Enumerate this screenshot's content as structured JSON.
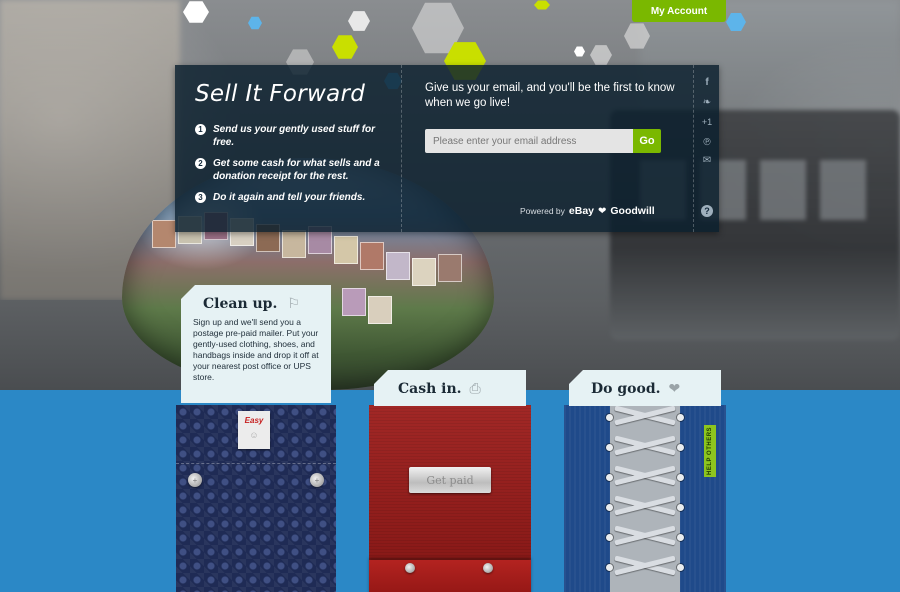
{
  "header": {
    "account_label": "My Account"
  },
  "signup": {
    "brand": "Sell It Forward",
    "steps": [
      {
        "num": "1",
        "text": "Send us your gently used stuff for free."
      },
      {
        "num": "2",
        "text": "Get some cash for what sells and a donation receipt for the rest."
      },
      {
        "num": "3",
        "text": "Do it again and tell your friends."
      }
    ],
    "prompt": "Give us your email, and you'll be the first to know when we go live!",
    "email_placeholder": "Please enter your email address",
    "go_label": "Go",
    "powered_by": "Powered by",
    "partner_1": "eBay",
    "partner_2": "Goodwill",
    "social_icons": [
      "facebook-icon",
      "twitter-icon",
      "google-plus-icon",
      "pinterest-icon",
      "email-icon"
    ],
    "social_glyphs": {
      "facebook": "f",
      "twitter": "❧",
      "google_plus": "+1",
      "pinterest": "℗",
      "email": "✉"
    },
    "help_glyph": "?"
  },
  "pockets": [
    {
      "title": "Clean up.",
      "description": "Sign up and we'll send you a postage pre-paid mailer. Put your gently-used clothing, shoes, and handbags inside and drop it off at your nearest post office or UPS store.",
      "label_text": "Easy",
      "icon": "spray-bottle-icon"
    },
    {
      "title": "Cash in.",
      "plate_text": "Get paid",
      "icon": "cash-register-icon"
    },
    {
      "title": "Do good.",
      "tag_text": "HELP OTHERS",
      "icon": "heart-icon"
    }
  ],
  "colors": {
    "accent_green": "#7ab800",
    "band_blue": "#2b88c6",
    "panel_bg": "#0a1e2d"
  }
}
